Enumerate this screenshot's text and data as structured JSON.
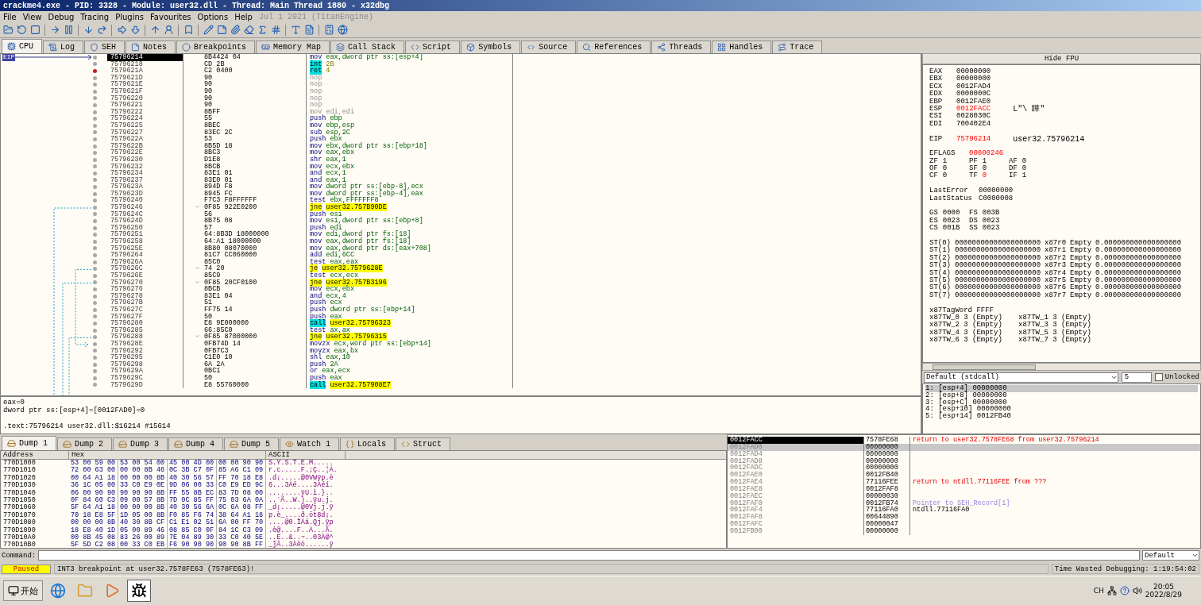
{
  "window": {
    "title": "crackme4.exe - PID: 3328 - Module: user32.dll - Thread: Main Thread 1880 - x32dbg"
  },
  "menu": {
    "items": [
      "File",
      "View",
      "Debug",
      "Tracing",
      "Plugins",
      "Favourites",
      "Options",
      "Help"
    ],
    "build": "Jul 1 2021 (TitanEngine)"
  },
  "tabs": [
    {
      "label": "CPU",
      "selected": true
    },
    {
      "label": "Log",
      "selected": false
    },
    {
      "label": "SEH",
      "selected": false
    },
    {
      "label": "Notes",
      "selected": false
    },
    {
      "label": "Breakpoints",
      "selected": false
    },
    {
      "label": "Memory Map",
      "selected": false
    },
    {
      "label": "Call Stack",
      "selected": false
    },
    {
      "label": "Script",
      "selected": false
    },
    {
      "label": "Symbols",
      "selected": false
    },
    {
      "label": "Source",
      "selected": false
    },
    {
      "label": "References",
      "selected": false
    },
    {
      "label": "Threads",
      "selected": false
    },
    {
      "label": "Handles",
      "selected": false
    },
    {
      "label": "Trace",
      "selected": false
    }
  ],
  "disassembly": {
    "eip_label": "EIP",
    "rows": [
      {
        "address": "75796214",
        "bytes": "8B4424 04",
        "kind": "normal",
        "mnemonic": "mov",
        "operands": "eax,dword ptr ss:[esp+4]",
        "selected": true,
        "breakpoint": false,
        "branch": false
      },
      {
        "address": "75796218",
        "bytes": "CD 2B",
        "kind": "int",
        "mnemonic": "int",
        "operands": "2B",
        "selected": false,
        "breakpoint": false,
        "branch": false
      },
      {
        "address": "7579621A",
        "bytes": "C2 0400",
        "kind": "ret",
        "mnemonic": "ret",
        "operands": "4",
        "selected": false,
        "breakpoint": true,
        "branch": false
      },
      {
        "address": "7579621D",
        "bytes": "90",
        "kind": "nop",
        "mnemonic": "nop",
        "selected": false,
        "breakpoint": false,
        "branch": false
      },
      {
        "address": "7579621E",
        "bytes": "90",
        "kind": "nop",
        "mnemonic": "nop",
        "selected": false,
        "breakpoint": false,
        "branch": false
      },
      {
        "address": "7579621F",
        "bytes": "90",
        "kind": "nop",
        "mnemonic": "nop",
        "selected": false,
        "breakpoint": false,
        "branch": false
      },
      {
        "address": "75796220",
        "bytes": "90",
        "kind": "nop",
        "mnemonic": "nop",
        "selected": false,
        "breakpoint": false,
        "branch": false
      },
      {
        "address": "75796221",
        "bytes": "90",
        "kind": "nop",
        "mnemonic": "nop",
        "selected": false,
        "breakpoint": false,
        "branch": false
      },
      {
        "address": "75796222",
        "bytes": "8BFF",
        "kind": "nop",
        "mnemonic": "mov",
        "operands": "edi,edi",
        "selected": false,
        "breakpoint": false,
        "branch": false
      },
      {
        "address": "75796224",
        "bytes": "55",
        "kind": "normal",
        "mnemonic": "push",
        "operands": "ebp",
        "selected": false,
        "breakpoint": false,
        "branch": false
      },
      {
        "address": "75796225",
        "bytes": "8BEC",
        "kind": "normal",
        "mnemonic": "mov",
        "operands": "ebp,esp",
        "selected": false,
        "breakpoint": false,
        "branch": false
      },
      {
        "address": "75796227",
        "bytes": "83EC 2C",
        "kind": "normal",
        "mnemonic": "sub",
        "operands": "esp,2C",
        "selected": false,
        "breakpoint": false,
        "branch": false
      },
      {
        "address": "7579622A",
        "bytes": "53",
        "kind": "normal",
        "mnemonic": "push",
        "operands": "ebx",
        "selected": false,
        "breakpoint": false,
        "branch": false
      },
      {
        "address": "7579622B",
        "bytes": "8B5D 18",
        "kind": "normal",
        "mnemonic": "mov",
        "operands": "ebx,dword ptr ss:[ebp+18]",
        "selected": false,
        "breakpoint": false,
        "branch": false
      },
      {
        "address": "7579622E",
        "bytes": "8BC3",
        "kind": "normal",
        "mnemonic": "mov",
        "operands": "eax,ebx",
        "selected": false,
        "breakpoint": false,
        "branch": false
      },
      {
        "address": "75796230",
        "bytes": "D1E8",
        "kind": "normal",
        "mnemonic": "shr",
        "operands": "eax,1",
        "selected": false,
        "breakpoint": false,
        "branch": false
      },
      {
        "address": "75796232",
        "bytes": "8BCB",
        "kind": "normal",
        "mnemonic": "mov",
        "operands": "ecx,ebx",
        "selected": false,
        "breakpoint": false,
        "branch": false
      },
      {
        "address": "75796234",
        "bytes": "83E1 01",
        "kind": "normal",
        "mnemonic": "and",
        "operands": "ecx,1",
        "selected": false,
        "breakpoint": false,
        "branch": false
      },
      {
        "address": "75796237",
        "bytes": "83E0 01",
        "kind": "normal",
        "mnemonic": "and",
        "operands": "eax,1",
        "selected": false,
        "breakpoint": false,
        "branch": false
      },
      {
        "address": "7579623A",
        "bytes": "894D F8",
        "kind": "normal",
        "mnemonic": "mov",
        "operands": "dword ptr ss:[ebp-8],ecx",
        "selected": false,
        "breakpoint": false,
        "branch": false
      },
      {
        "address": "7579623D",
        "bytes": "8945 FC",
        "kind": "normal",
        "mnemonic": "mov",
        "operands": "dword ptr ss:[ebp-4],eax",
        "selected": false,
        "breakpoint": false,
        "branch": false
      },
      {
        "address": "75796240",
        "bytes": "F7C3 F8FFFFFF",
        "kind": "normal",
        "mnemonic": "test",
        "operands": "ebx,FFFFFFF8",
        "selected": false,
        "breakpoint": false,
        "branch": false
      },
      {
        "address": "75796246",
        "bytes": "0F85 922E0200",
        "kind": "jump",
        "mnemonic": "jne",
        "operands": "user32.757B90DE",
        "selected": false,
        "breakpoint": false,
        "branch": true
      },
      {
        "address": "7579624C",
        "bytes": "56",
        "kind": "normal",
        "mnemonic": "push",
        "operands": "esi",
        "selected": false,
        "breakpoint": false,
        "branch": false
      },
      {
        "address": "7579624D",
        "bytes": "8B75 08",
        "kind": "normal",
        "mnemonic": "mov",
        "operands": "esi,dword ptr ss:[ebp+8]",
        "selected": false,
        "breakpoint": false,
        "branch": false
      },
      {
        "address": "75796250",
        "bytes": "57",
        "kind": "normal",
        "mnemonic": "push",
        "operands": "edi",
        "selected": false,
        "breakpoint": false,
        "branch": false
      },
      {
        "address": "75796251",
        "bytes": "64:8B3D 18000000",
        "kind": "normal",
        "mnemonic": "mov",
        "operands": "edi,dword ptr fs:[18]",
        "selected": false,
        "breakpoint": false,
        "branch": false
      },
      {
        "address": "75796258",
        "bytes": "64:A1 18000000",
        "kind": "normal",
        "mnemonic": "mov",
        "operands": "eax,dword ptr fs:[18]",
        "selected": false,
        "breakpoint": false,
        "branch": false
      },
      {
        "address": "7579625E",
        "bytes": "8B80 08070000",
        "kind": "normal",
        "mnemonic": "mov",
        "operands": "eax,dword ptr ds:[eax+708]",
        "selected": false,
        "breakpoint": false,
        "branch": false
      },
      {
        "address": "75796264",
        "bytes": "81C7 CC060000",
        "kind": "normal",
        "mnemonic": "add",
        "operands": "edi,6CC",
        "selected": false,
        "breakpoint": false,
        "branch": false
      },
      {
        "address": "7579626A",
        "bytes": "85C0",
        "kind": "normal",
        "mnemonic": "test",
        "operands": "eax,eax",
        "selected": false,
        "breakpoint": false,
        "branch": false
      },
      {
        "address": "7579626C",
        "bytes": "74 20",
        "kind": "jump",
        "mnemonic": "je",
        "operands": "user32.7579628E",
        "selected": false,
        "breakpoint": false,
        "branch": true
      },
      {
        "address": "7579626E",
        "bytes": "85C9",
        "kind": "normal",
        "mnemonic": "test",
        "operands": "ecx,ecx",
        "selected": false,
        "breakpoint": false,
        "branch": false
      },
      {
        "address": "75796270",
        "bytes": "0F85 20CF0100",
        "kind": "jump",
        "mnemonic": "jne",
        "operands": "user32.757B3196",
        "selected": false,
        "breakpoint": false,
        "branch": true
      },
      {
        "address": "75796276",
        "bytes": "8BCB",
        "kind": "normal",
        "mnemonic": "mov",
        "operands": "ecx,ebx",
        "selected": false,
        "breakpoint": false,
        "branch": false
      },
      {
        "address": "75796278",
        "bytes": "83E1 04",
        "kind": "normal",
        "mnemonic": "and",
        "operands": "ecx,4",
        "selected": false,
        "breakpoint": false,
        "branch": false
      },
      {
        "address": "7579627B",
        "bytes": "51",
        "kind": "normal",
        "mnemonic": "push",
        "operands": "ecx",
        "selected": false,
        "breakpoint": false,
        "branch": false
      },
      {
        "address": "7579627C",
        "bytes": "FF75 14",
        "kind": "normal",
        "mnemonic": "push",
        "operands": "dword ptr ss:[ebp+14]",
        "selected": false,
        "breakpoint": false,
        "branch": false
      },
      {
        "address": "7579627F",
        "bytes": "50",
        "kind": "normal",
        "mnemonic": "push",
        "operands": "eax",
        "selected": false,
        "breakpoint": false,
        "branch": false
      },
      {
        "address": "75796280",
        "bytes": "E8 9E000000",
        "kind": "call",
        "mnemonic": "call",
        "operands": "user32.75796323",
        "selected": false,
        "breakpoint": false,
        "branch": false
      },
      {
        "address": "75796285",
        "bytes": "66:85C0",
        "kind": "normal",
        "mnemonic": "test",
        "operands": "ax,ax",
        "selected": false,
        "breakpoint": false,
        "branch": false
      },
      {
        "address": "75796288",
        "bytes": "0F85 87000000",
        "kind": "jump",
        "mnemonic": "jne",
        "operands": "user32.75796315",
        "selected": false,
        "breakpoint": false,
        "branch": true
      },
      {
        "address": "7579628E",
        "bytes": "0FB74D 14",
        "kind": "normal",
        "mnemonic": "movzx",
        "operands": "ecx,word ptr ss:[ebp+14]",
        "selected": false,
        "breakpoint": false,
        "branch": false
      },
      {
        "address": "75796292",
        "bytes": "0FB7C3",
        "kind": "normal",
        "mnemonic": "movzx",
        "operands": "eax,bx",
        "selected": false,
        "breakpoint": false,
        "branch": false
      },
      {
        "address": "75796295",
        "bytes": "C1E0 10",
        "kind": "normal",
        "mnemonic": "shl",
        "operands": "eax,10",
        "selected": false,
        "breakpoint": false,
        "branch": false
      },
      {
        "address": "75796298",
        "bytes": "6A 2A",
        "kind": "normal",
        "mnemonic": "push",
        "operands": "2A",
        "selected": false,
        "breakpoint": false,
        "branch": false
      },
      {
        "address": "7579629A",
        "bytes": "0BC1",
        "kind": "normal",
        "mnemonic": "or",
        "operands": "eax,ecx",
        "selected": false,
        "breakpoint": false,
        "branch": false
      },
      {
        "address": "7579629C",
        "bytes": "50",
        "kind": "normal",
        "mnemonic": "push",
        "operands": "eax",
        "selected": false,
        "breakpoint": false,
        "branch": false
      },
      {
        "address": "7579629D",
        "bytes": "E8 55760000",
        "kind": "call",
        "mnemonic": "call",
        "operands": "user32.757908E7",
        "selected": false,
        "breakpoint": false,
        "branch": false
      }
    ]
  },
  "info": [
    "eax=0",
    "dword ptr ss:[esp+4]=[0012FAD0]=0",
    ".text:75796214 user32.dll:$16214 #15614"
  ],
  "registers": {
    "header": "Hide FPU",
    "general": [
      {
        "name": "EAX",
        "value": "00000000",
        "changed": false
      },
      {
        "name": "EBX",
        "value": "00000000",
        "changed": false
      },
      {
        "name": "ECX",
        "value": "0012FAD4",
        "changed": false
      },
      {
        "name": "EDX",
        "value": "0000000C",
        "changed": false
      },
      {
        "name": "EBP",
        "value": "0012FAE0",
        "changed": false
      },
      {
        "name": "ESP",
        "value": "0012FACC",
        "changed": true,
        "comment": "L\"\\ 瞱\""
      },
      {
        "name": "ESI",
        "value": "0028030C",
        "changed": false
      },
      {
        "name": "EDI",
        "value": "700402E4",
        "changed": false
      }
    ],
    "eip": {
      "name": "EIP",
      "value": "75796214",
      "changed": true,
      "comment": "user32.75796214"
    },
    "eflags": {
      "name": "EFLAGS",
      "value": "00000246",
      "changed": true
    },
    "flags": [
      [
        {
          "name": "ZF",
          "value": "1",
          "changed": false
        },
        {
          "name": "PF",
          "value": "1",
          "changed": false
        },
        {
          "name": "AF",
          "value": "0",
          "changed": false
        }
      ],
      [
        {
          "name": "OF",
          "value": "0",
          "changed": false
        },
        {
          "name": "SF",
          "value": "0",
          "changed": false
        },
        {
          "name": "DF",
          "value": "0",
          "changed": false
        }
      ],
      [
        {
          "name": "CF",
          "value": "0",
          "changed": false
        },
        {
          "name": "TF",
          "value": "0",
          "changed": true
        },
        {
          "name": "IF",
          "value": "1",
          "changed": false
        }
      ]
    ],
    "status": [
      {
        "name": "LastError",
        "value": "00000000"
      },
      {
        "name": "LastStatus",
        "value": "C0000008"
      }
    ],
    "segments": [
      [
        {
          "name": "GS",
          "value": "0000"
        },
        {
          "name": "FS",
          "value": "003B"
        }
      ],
      [
        {
          "name": "ES",
          "value": "0023"
        },
        {
          "name": "DS",
          "value": "0023"
        }
      ],
      [
        {
          "name": "CS",
          "value": "001B"
        },
        {
          "name": "SS",
          "value": "0023"
        }
      ]
    ],
    "fpu": [
      {
        "name": "ST(0)",
        "raw": "00000000000000000000",
        "reg": "x87r0",
        "tag": "Empty",
        "value": "0.000000000000000000"
      },
      {
        "name": "ST(1)",
        "raw": "00000000000000000000",
        "reg": "x87r1",
        "tag": "Empty",
        "value": "0.000000000000000000"
      },
      {
        "name": "ST(2)",
        "raw": "00000000000000000000",
        "reg": "x87r2",
        "tag": "Empty",
        "value": "0.000000000000000000"
      },
      {
        "name": "ST(3)",
        "raw": "00000000000000000000",
        "reg": "x87r3",
        "tag": "Empty",
        "value": "0.000000000000000000"
      },
      {
        "name": "ST(4)",
        "raw": "00000000000000000000",
        "reg": "x87r4",
        "tag": "Empty",
        "value": "0.000000000000000000"
      },
      {
        "name": "ST(5)",
        "raw": "00000000000000000000",
        "reg": "x87r5",
        "tag": "Empty",
        "value": "0.000000000000000000"
      },
      {
        "name": "ST(6)",
        "raw": "00000000000000000000",
        "reg": "x87r6",
        "tag": "Empty",
        "value": "0.000000000000000000"
      },
      {
        "name": "ST(7)",
        "raw": "00000000000000000000",
        "reg": "x87r7",
        "tag": "Empty",
        "value": "0.000000000000000000"
      }
    ],
    "tagword": "x87TagWord FFFF",
    "tag_entries": [
      [
        "x87TW_0 3 (Empty)",
        "x87TW_1 3 (Empty)"
      ],
      [
        "x87TW_2 3 (Empty)",
        "x87TW_3 3 (Empty)"
      ],
      [
        "x87TW_4 3 (Empty)",
        "x87TW_5 3 (Empty)"
      ],
      [
        "x87TW_6 3 (Empty)",
        "x87TW_7 3 (Empty)"
      ]
    ]
  },
  "arguments": {
    "convention": "Default (stdcall)",
    "count": "5",
    "locked": {
      "label": "Unlocked",
      "checked": false
    },
    "rows": [
      "1: [esp+4] 00000000",
      "2: [esp+8] 00000000",
      "3: [esp+C] 00000000",
      "4: [esp+10] 00000000",
      "5: [esp+14] 0012FB40"
    ]
  },
  "dump_tabs": [
    {
      "label": "Dump 1",
      "selected": true
    },
    {
      "label": "Dump 2",
      "selected": false
    },
    {
      "label": "Dump 3",
      "selected": false
    },
    {
      "label": "Dump 4",
      "selected": false
    },
    {
      "label": "Dump 5",
      "selected": false
    },
    {
      "label": "Watch 1",
      "selected": false
    },
    {
      "label": "Locals",
      "selected": false
    },
    {
      "label": "Struct",
      "selected": false
    }
  ],
  "dump": {
    "columns": [
      "Address",
      "Hex",
      "ASCII"
    ],
    "rows": [
      {
        "address": "770D1000",
        "hex": [
          "53 00 59 00",
          "53 00 54 00",
          "45 00 4D 00",
          "00 00 90 90"
        ],
        "ascii": "S.Y.S.T.E.M....."
      },
      {
        "address": "770D1010",
        "hex": [
          "72 00 63 00",
          "00 00 8B 46",
          "0C 3B C7 0F",
          "85 A6 C1 09"
        ],
        "ascii": "r.c.....F.;Ç..¦Á."
      },
      {
        "address": "770D1020",
        "hex": [
          "00 64 A1 18",
          "00 00 00 8B",
          "40 30 56 57",
          "FF 70 18 E8"
        ],
        "ascii": ".d¡.....@0VWÿp.è"
      },
      {
        "address": "770D1030",
        "hex": [
          "36 1C 05 00",
          "33 C0 E9 0E",
          "9D 06 00 33",
          "C0 E9 ED 9C"
        ],
        "ascii": "6...3Àé....3Àéí."
      },
      {
        "address": "770D1040",
        "hex": [
          "06 00 90 90",
          "90 90 90 8B",
          "FF 55 8B EC",
          "83 7D 08 00"
        ],
        "ascii": "........ÿU.ì.}.."
      },
      {
        "address": "770D1050",
        "hex": [
          "0F 84 60 C3",
          "09 00 57 8B",
          "7D 0C 85 FF",
          "75 03 6A 0A"
        ],
        "ascii": "..`Ã..W.}..ÿu.j."
      },
      {
        "address": "770D1060",
        "hex": [
          "5F 64 A1 18",
          "00 00 00 8B",
          "40 30 56 6A",
          "0C 6A 08 FF"
        ],
        "ascii": "_d¡.....@0Vj.j.ÿ"
      },
      {
        "address": "770D1070",
        "hex": [
          "70 18 E8 5F",
          "1D 05 00 8B",
          "F0 85 F6 74",
          "38 64 A1 18"
        ],
        "ascii": "p.è_....ð.öt8d¡."
      },
      {
        "address": "770D1080",
        "hex": [
          "00 00 00 8B",
          "40 30 8B CF",
          "C1 E1 02 51",
          "6A 00 FF 70"
        ],
        "ascii": "....@0.ÏÁá.Qj.ÿp"
      },
      {
        "address": "770D1090",
        "hex": [
          "18 E8 40 1D",
          "05 00 89 46",
          "08 85 C0 0F",
          "84 1C C3 09"
        ],
        "ascii": ".è@....F..À...Ã."
      },
      {
        "address": "770D10A0",
        "hex": [
          "00 8B 45 08",
          "83 26 00 89",
          "7E 04 89 30",
          "33 C0 40 5E"
        ],
        "ascii": "..E..&..~..03À@^"
      },
      {
        "address": "770D10B0",
        "hex": [
          "5F 5D C2 08",
          "00 33 C0 EB",
          "F6 90 90 90",
          "90 90 8B FF"
        ],
        "ascii": "_]Â..3Àëö......ÿ"
      }
    ]
  },
  "stack": [
    {
      "address": "0012FACC",
      "value": "7578FE68",
      "comment": "return to user32.7578FE68 from user32.75796214",
      "kind": "return",
      "selected": true
    },
    {
      "address": "0012FAD0",
      "value": "00000000",
      "selected": false
    },
    {
      "address": "0012FAD4",
      "value": "00000000",
      "selected": false
    },
    {
      "address": "0012FAD8",
      "value": "00000000",
      "selected": false
    },
    {
      "address": "0012FADC",
      "value": "00000000",
      "selected": false
    },
    {
      "address": "0012FAE0",
      "value": "0012FB40",
      "selected": false
    },
    {
      "address": "0012FAE4",
      "value": "77116FEE",
      "comment": "return to ntdll.77116FEE from ???",
      "kind": "return",
      "selected": false
    },
    {
      "address": "0012FAE8",
      "value": "0012FAF8",
      "selected": false
    },
    {
      "address": "0012FAEC",
      "value": "00000030",
      "selected": false
    },
    {
      "address": "0012FAF0",
      "value": "0012FB74",
      "comment": "Pointer to SEH_Record[1]",
      "kind": "pointer",
      "selected": false
    },
    {
      "address": "0012FAF4",
      "value": "77116FA0",
      "comment": "ntdll.77116FA0",
      "kind": "plain",
      "selected": false
    },
    {
      "address": "0012FAF8",
      "value": "00644890",
      "selected": false
    },
    {
      "address": "0012FAFC",
      "value": "00000047",
      "selected": false
    },
    {
      "address": "0012FB00",
      "value": "00000000",
      "selected": false
    }
  ],
  "command": {
    "label": "Command:",
    "mode": "Default"
  },
  "status_bar": {
    "state": "Paused",
    "message": "INT3 breakpoint at user32.7578FE63 (7578FE63)!",
    "time": "Time Wasted Debugging: 1:19:54:02"
  },
  "taskbar": {
    "start": "开始",
    "language": "CH",
    "time": "20:05",
    "date": "2022/8/29"
  }
}
